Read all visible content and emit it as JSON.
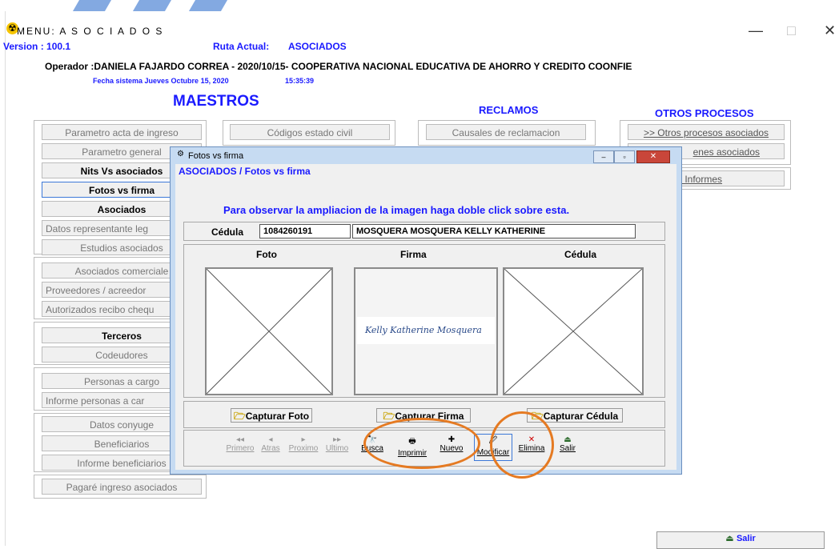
{
  "window": {
    "title": "MENU: A S O C I A D O S",
    "min": "—",
    "max": "□",
    "close": "✕"
  },
  "header": {
    "version": "Version : 100.1",
    "ruta_label": "Ruta Actual:",
    "ruta_value": "ASOCIADOS",
    "operator": "Operador :DANIELA FAJARDO CORREA - 2020/10/15- COOPERATIVA NACIONAL EDUCATIVA DE AHORRO Y CREDITO COONFIE",
    "fecha": "Fecha sistema Jueves Octubre 15, 2020",
    "hora": "15:35:39"
  },
  "sections": {
    "maestros": "MAESTROS",
    "reclamos": "RECLAMOS",
    "otros": "OTROS PROCESOS"
  },
  "left_menu": [
    "Parametro acta de ingreso",
    "Parametro general",
    "Nits Vs asociados",
    "Fotos vs firma",
    "Asociados",
    "Datos representante leg",
    "Estudios asociados",
    "Asociados comerciale",
    "Proveedores / acreedor",
    "Autorizados recibo chequ",
    "Terceros",
    "Codeudores",
    "Personas a cargo",
    "Informe personas a car",
    "Datos conyuge",
    "Beneficiarios",
    "Informe beneficiarios",
    "Pagaré ingreso asociados"
  ],
  "col2_menu": [
    "Códigos estado civil"
  ],
  "reclamos_menu": [
    "Causales de reclamacion"
  ],
  "otros_menu": [
    ">> Otros procesos asociados",
    "enes asociados",
    "> Informes"
  ],
  "salir_main": "Salir",
  "dialog": {
    "title": "Fotos vs firma",
    "breadcrumb": "ASOCIADOS / Fotos vs firma",
    "instruction": "Para observar  la ampliacion de la imagen haga doble click sobre esta.",
    "cedula_label": "Cédula",
    "cedula_value": "1084260191",
    "nombre": "MOSQUERA MOSQUERA KELLY KATHERINE",
    "foto_label": "Foto",
    "firma_label": "Firma",
    "cedula_col": "Cédula",
    "signature_text": "Kelly Katherine Mosquera",
    "capturar_foto": "Capturar Foto",
    "capturar_firma": "Capturar Firma",
    "capturar_cedula": "Capturar Cédula",
    "toolbar": [
      {
        "label": "Primero",
        "icon": "◂◂",
        "enabled": false
      },
      {
        "label": "Atras",
        "icon": "◂",
        "enabled": false
      },
      {
        "label": "Proximo",
        "icon": "▸",
        "enabled": false
      },
      {
        "label": "Ultimo",
        "icon": "▸▸",
        "enabled": false
      },
      {
        "label": "Busca",
        "icon": "🔭",
        "enabled": true
      },
      {
        "label": "Imprimir",
        "icon": "🖶",
        "enabled": true
      },
      {
        "label": "Nuevo",
        "icon": "✚",
        "enabled": true
      },
      {
        "label": "Modificar",
        "icon": "🖉",
        "enabled": true
      },
      {
        "label": "Elimina",
        "icon": "✕",
        "enabled": true
      },
      {
        "label": "Salir",
        "icon": "⏏",
        "enabled": true
      }
    ]
  },
  "colors": {
    "accent": "#1a1aff",
    "highlight": "#e57a22",
    "dialog_frame": "#c6dbf2"
  }
}
